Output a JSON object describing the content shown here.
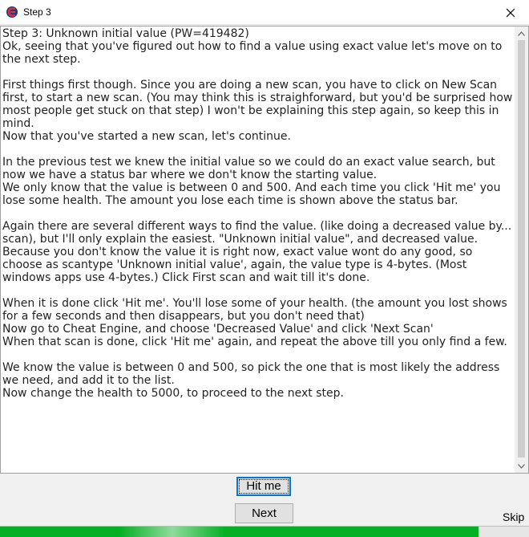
{
  "window": {
    "title": "Step 3",
    "app_icon": "cheat-engine-icon",
    "close_icon": "close-icon"
  },
  "tutorial": {
    "paragraphs": [
      [
        "Step 3: Unknown initial value (PW=419482)",
        "Ok, seeing that you've figured out how to find a value using exact value let's move on to the next step."
      ],
      [
        "First things first though. Since you are doing a new scan, you have to click on New Scan first, to start a new scan. (You may think this is straighforward, but you'd be surprised how most people get stuck on that step) I won't be explaining this step again, so keep this in mind.",
        "Now that you've started a new scan, let's continue."
      ],
      [
        "In the previous test we knew the initial value so we could do an exact value search, but now we have a status bar where we don't know the starting value.",
        "We only know that the value is between 0 and 500. And each time you click 'Hit me' you lose some health. The amount you lose each time is shown above the status bar."
      ],
      [
        "Again there are several different ways to find the value. (like doing a decreased value by... scan), but I'll only explain the easiest. \"Unknown initial value\", and decreased value.",
        "Because you don't know the value it is right now, exact value wont do any good, so choose as scantype 'Unknown initial value', again, the value type is 4-bytes. (Most windows apps use 4-bytes.) Click First scan and wait till it's done."
      ],
      [
        "When it is done click 'Hit me'. You'll lose some of your health. (the amount you lost shows for a few seconds and then disappears, but you don't need that)",
        "Now go to Cheat Engine, and choose 'Decreased Value' and click 'Next Scan'",
        "When that scan is done, click 'Hit me' again, and repeat the above till you only find a few."
      ],
      [
        "We know the value is between 0 and 500, so pick the one that is most likely the address we need, and add it to the list.",
        "Now change the health to 5000, to proceed to the next step."
      ]
    ]
  },
  "buttons": {
    "hit_me": "Hit me",
    "next": "Next",
    "skip": "Skip"
  },
  "health_bar": {
    "fraction": 0.905,
    "color": "#06b025"
  }
}
